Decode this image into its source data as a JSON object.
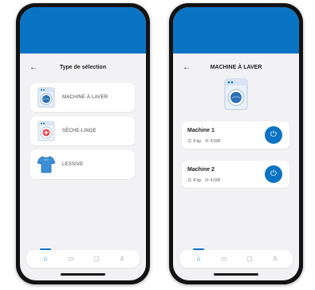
{
  "left_screen": {
    "title": "Type de sélection",
    "back_icon": "arrow-left-icon",
    "options": [
      {
        "label": "MACHINE À LAVER",
        "icon": "washing-machine-icon"
      },
      {
        "label": "SÈCHE-LINGE",
        "icon": "dryer-icon"
      },
      {
        "label": "LESSIVE",
        "icon": "tshirt-icon"
      }
    ]
  },
  "right_screen": {
    "title": "MACHINE À LAVER",
    "back_icon": "arrow-left-icon",
    "machines": [
      {
        "name": "Machine 1",
        "weight": "8 kg",
        "price": "4,50€"
      },
      {
        "name": "Machine 2",
        "weight": "8 kg",
        "price": "4,50€"
      }
    ]
  },
  "nav": [
    {
      "icon": "home-icon",
      "active": true
    },
    {
      "icon": "document-icon",
      "active": false
    },
    {
      "icon": "wallet-icon",
      "active": false
    },
    {
      "icon": "user-icon",
      "active": false
    }
  ],
  "colors": {
    "accent": "#0a74c4",
    "background": "#f2f2f4",
    "phone_frame": "#121212"
  }
}
